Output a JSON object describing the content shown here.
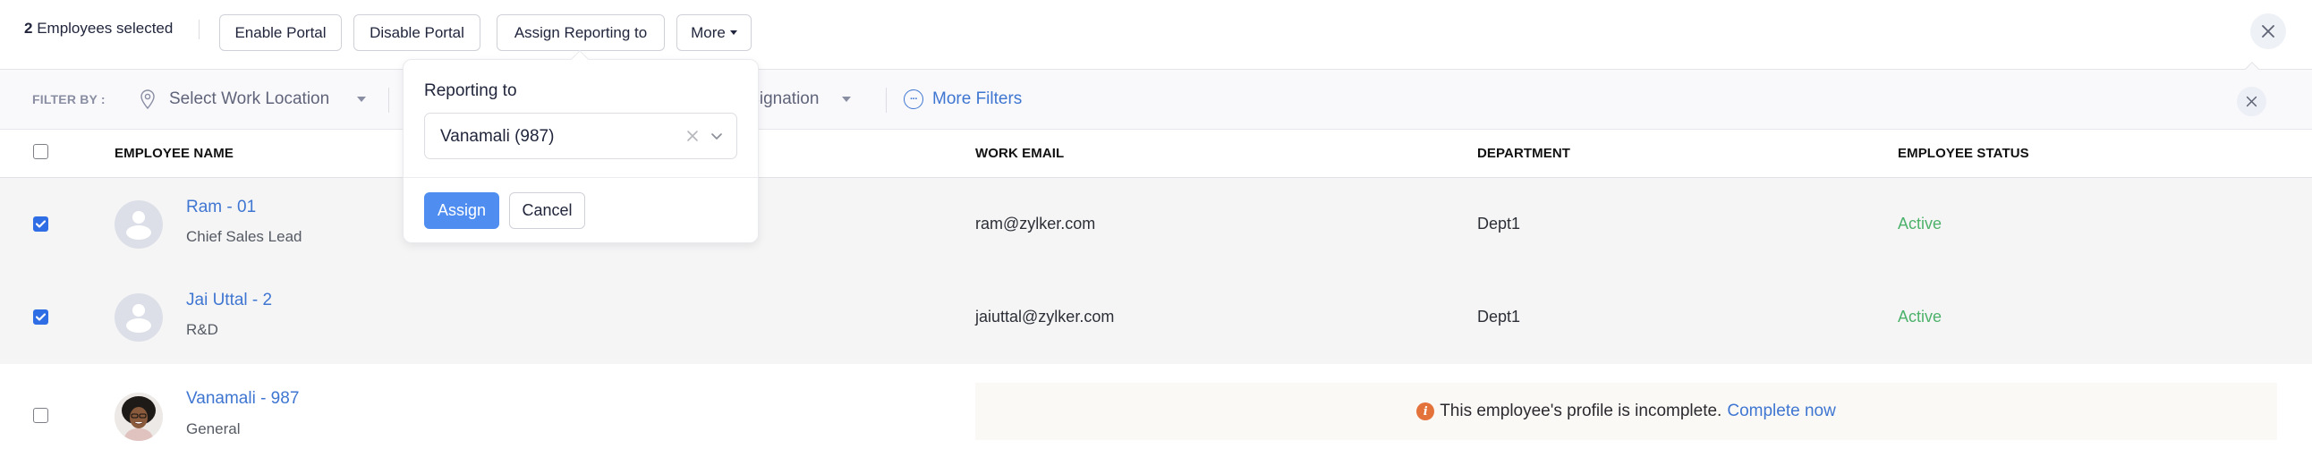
{
  "topbar": {
    "selected_count": "2",
    "selected_suffix": " Employees selected",
    "actions": [
      {
        "label": "Enable Portal"
      },
      {
        "label": "Disable Portal"
      },
      {
        "label": "Assign Reporting to"
      },
      {
        "label": "More"
      }
    ],
    "close_icon": "close-icon"
  },
  "filterbar": {
    "label": "FILTER BY :",
    "location_placeholder": "Select Work Location",
    "designation_placeholder": "Select Designation",
    "more_filters": "More Filters"
  },
  "table": {
    "columns": [
      "EMPLOYEE NAME",
      "WORK EMAIL",
      "DEPARTMENT",
      "EMPLOYEE STATUS"
    ],
    "rows": [
      {
        "name": "Ram - 01",
        "designation": "Chief Sales Lead",
        "email": "ram@zylker.com",
        "department": "Dept1",
        "status": "Active",
        "selected": true
      },
      {
        "name": "Jai Uttal - 2",
        "designation": "R&D",
        "email": "jaiuttal@zylker.com",
        "department": "Dept1",
        "status": "Active",
        "selected": true
      },
      {
        "name": "Vanamali - 987",
        "designation": "General",
        "selected": false,
        "notice": "This employee's profile is incomplete.",
        "notice_link": "Complete now"
      }
    ]
  },
  "popover": {
    "label": "Reporting to",
    "selected_value": "Vanamali (987)",
    "assign_label": "Assign",
    "cancel_label": "Cancel"
  },
  "colors": {
    "accent": "#3f76d1",
    "primary_button": "#4f8df0",
    "checkbox": "#2f6de5",
    "active_status": "#4cb26a",
    "warning_icon": "#e4733b"
  }
}
